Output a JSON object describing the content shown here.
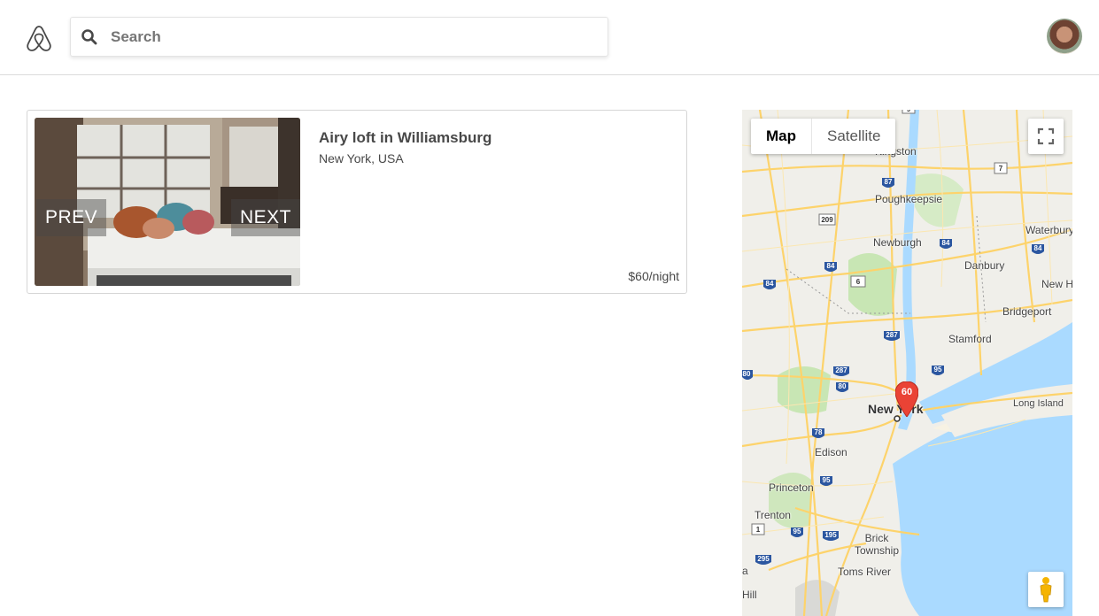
{
  "search": {
    "placeholder": "Search"
  },
  "listing": {
    "title": "Airy loft in Williamsburg",
    "location": "New York, USA",
    "price": "$60/night",
    "prev_label": "PREV",
    "next_label": "NEXT"
  },
  "map": {
    "type_map": "Map",
    "type_satellite": "Satellite",
    "marker_label": "60",
    "places": [
      "Kingston",
      "Poughkeepsie",
      "Newburgh",
      "Danbury",
      "Waterbury",
      "New H",
      "Bridgeport",
      "Stamford",
      "New York",
      "Long Island",
      "Edison",
      "Princeton",
      "Trenton",
      "Brick Township",
      "Toms River",
      "a",
      "Hill"
    ],
    "route_shields": [
      "87",
      "9",
      "209",
      "84",
      "84",
      "84",
      "6",
      "84",
      "7",
      "287",
      "287",
      "95",
      "80",
      "80",
      "78",
      "95",
      "1",
      "95",
      "195",
      "295"
    ]
  },
  "colors": {
    "accent": "#ff5a5f",
    "marker": "#ea4335",
    "road": "#fdd36b",
    "water": "#aadaff",
    "park": "#c8e6b4"
  }
}
